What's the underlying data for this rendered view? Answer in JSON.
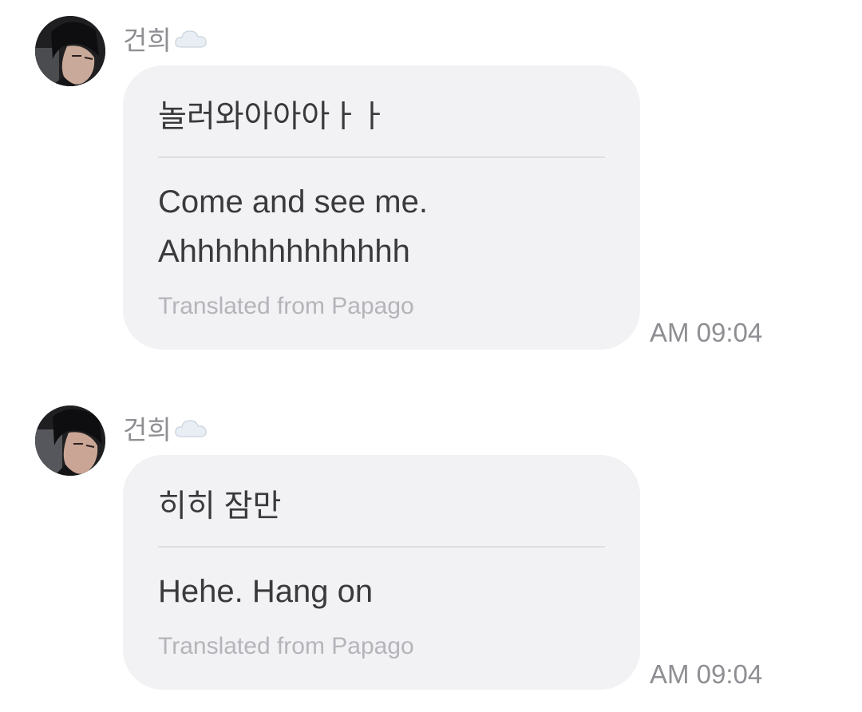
{
  "messages": [
    {
      "sender": "건희",
      "sender_emoji_icon": "cloud-icon",
      "original": "놀러와아아아ㅏㅏ",
      "translation_lines": [
        "Come and see me.",
        "Ahhhhhhhhhhhhh"
      ],
      "source_note": "Translated from Papago",
      "time": "AM 09:04"
    },
    {
      "sender": "건희",
      "sender_emoji_icon": "cloud-icon",
      "original": "히히 잠만",
      "translation_lines": [
        "Hehe. Hang on"
      ],
      "source_note": "Translated from Papago",
      "time": "AM 09:04"
    }
  ],
  "colors": {
    "bubble_bg": "#f2f2f4",
    "text": "#3a3a3c",
    "secondary": "#8e8e93",
    "note": "#b4b4ba"
  }
}
